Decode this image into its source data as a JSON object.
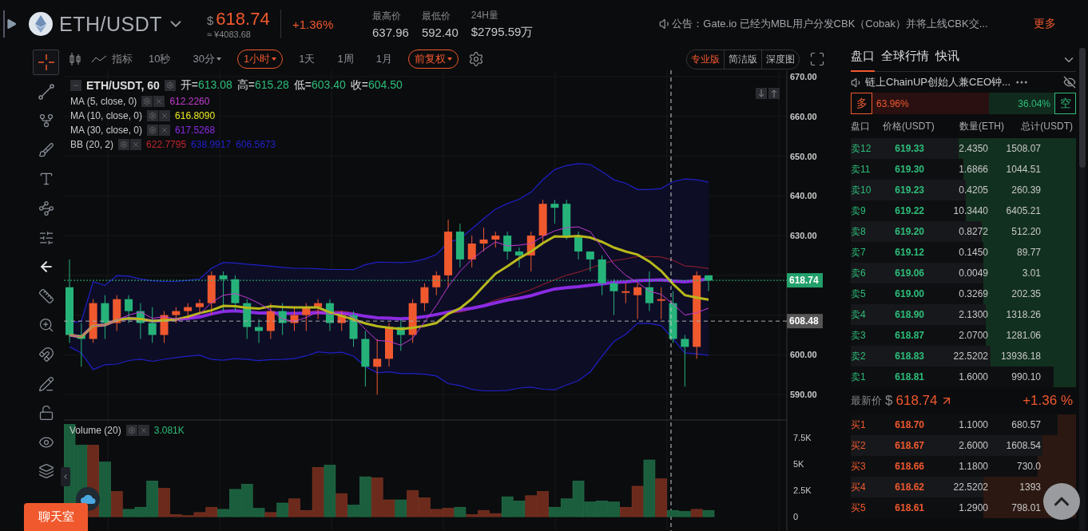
{
  "header": {
    "pair": "ETH/USDT",
    "price_symbol": "$",
    "price": "618.74",
    "price_cny": "≈ ¥4083.68",
    "change": "+1.36%",
    "stats": [
      {
        "label": "最高价",
        "value": "637.96"
      },
      {
        "label": "最低价",
        "value": "592.40"
      },
      {
        "label": "24H量",
        "value": "$2795.59万"
      }
    ],
    "notice": "公告：Gate.io 已经为MBL用户分发CBK（Cobak）并将上线CBK交...",
    "more": "更多"
  },
  "tools": [
    {
      "kind": "crosshair",
      "selected": true
    },
    {
      "kind": "line",
      "selected": false
    },
    {
      "kind": "fork",
      "selected": false
    },
    {
      "kind": "brush",
      "selected": false
    },
    {
      "kind": "text",
      "selected": false
    },
    {
      "kind": "pattern",
      "selected": false
    },
    {
      "kind": "sliders",
      "selected": false
    },
    {
      "kind": "back",
      "selected": false
    },
    {
      "kind": "ruler",
      "selected": false
    },
    {
      "kind": "zoom",
      "selected": false
    },
    {
      "kind": "magnet",
      "selected": false
    },
    {
      "kind": "pencil",
      "selected": false
    },
    {
      "kind": "unlock",
      "selected": false
    },
    {
      "kind": "eye",
      "selected": false
    },
    {
      "kind": "layers",
      "selected": false
    }
  ],
  "chart_toolbar": {
    "indicator_label": "指标",
    "intervals": [
      {
        "label": "10秒",
        "menu": false,
        "selected": false
      },
      {
        "label": "30分",
        "menu": true,
        "selected": false
      },
      {
        "label": "1小时",
        "menu": true,
        "selected": true
      },
      {
        "label": "1天",
        "menu": false,
        "selected": false
      },
      {
        "label": "1周",
        "menu": false,
        "selected": false
      },
      {
        "label": "1月",
        "menu": false,
        "selected": false
      }
    ],
    "adjust": "前复权",
    "views": [
      {
        "label": "专业版",
        "selected": true
      },
      {
        "label": "简洁版",
        "selected": false
      },
      {
        "label": "深度图",
        "selected": false
      }
    ]
  },
  "legend": {
    "title": "ETH/USDT, 60",
    "ohlc": [
      {
        "label": "开=",
        "value": "613.08"
      },
      {
        "label": "高=",
        "value": "615.28"
      },
      {
        "label": "低=",
        "value": "603.40"
      },
      {
        "label": "收=",
        "value": "604.50"
      }
    ],
    "indicators": [
      {
        "name": "MA (5, close, 0)",
        "values": [
          {
            "text": "612.2260",
            "color": "#c23ccf"
          }
        ]
      },
      {
        "name": "MA (10, close, 0)",
        "values": [
          {
            "text": "616.8090",
            "color": "#e8e820"
          }
        ]
      },
      {
        "name": "MA (30, close, 0)",
        "values": [
          {
            "text": "617.5268",
            "color": "#8a2be2"
          }
        ]
      },
      {
        "name": "BB (20, 2)",
        "values": [
          {
            "text": "622.7795",
            "color": "#c0262d"
          },
          {
            "text": "638.9917",
            "color": "#2020c8"
          },
          {
            "text": "606.5673",
            "color": "#2020c8"
          }
        ]
      }
    ]
  },
  "price_chart": {
    "axis_labels": [
      "670.00",
      "660.00",
      "650.00",
      "640.00",
      "630.00",
      "600.00",
      "590.00"
    ],
    "price_tags": [
      {
        "kind": "last",
        "text": "618.74"
      },
      {
        "kind": "cross",
        "text": "608.48"
      }
    ]
  },
  "volume": {
    "title": "Volume (20)",
    "value": "3.081K",
    "axis_labels": [
      "7.5K",
      "5K",
      "2.5K",
      "0"
    ]
  },
  "chat_button": "聊天室",
  "right_panel": {
    "tabs": [
      {
        "label": "盘口",
        "selected": true
      },
      {
        "label": "全球行情",
        "selected": false
      },
      {
        "label": "快讯",
        "selected": false
      }
    ],
    "notice": "链上ChainUP创始人兼CEO钟...",
    "sentiment": {
      "long_label": "多",
      "long_value": "63.96%",
      "short_value": "36.04%",
      "short_label": "空",
      "level": 0.6396
    },
    "columns": [
      "盘口",
      "价格(USDT)",
      "数量(ETH)",
      "总计(USDT)"
    ],
    "asks": [
      {
        "label": "卖12",
        "price": "619.33",
        "amount": "2.4350",
        "total": "1508.07",
        "level": 0.52
      },
      {
        "label": "卖11",
        "price": "619.30",
        "amount": "1.6866",
        "total": "1044.51",
        "level": 0.5
      },
      {
        "label": "卖10",
        "price": "619.23",
        "amount": "0.4205",
        "total": "260.39",
        "level": 0.49
      },
      {
        "label": "卖9",
        "price": "619.22",
        "amount": "10.3440",
        "total": "6405.21",
        "level": 0.49
      },
      {
        "label": "卖8",
        "price": "619.20",
        "amount": "0.8272",
        "total": "512.20",
        "level": 0.42
      },
      {
        "label": "卖7",
        "price": "619.12",
        "amount": "0.1450",
        "total": "89.77",
        "level": 0.41
      },
      {
        "label": "卖6",
        "price": "619.06",
        "amount": "0.0049",
        "total": "3.01",
        "level": 0.41
      },
      {
        "label": "卖5",
        "price": "619.00",
        "amount": "0.3269",
        "total": "202.35",
        "level": 0.41
      },
      {
        "label": "卖4",
        "price": "618.90",
        "amount": "2.1300",
        "total": "1318.26",
        "level": 0.4
      },
      {
        "label": "卖3",
        "price": "618.87",
        "amount": "2.0700",
        "total": "1281.06",
        "level": 0.4
      },
      {
        "label": "卖2",
        "price": "618.83",
        "amount": "22.5202",
        "total": "13936.18",
        "level": 0.38
      },
      {
        "label": "卖1",
        "price": "618.81",
        "amount": "1.6000",
        "total": "990.10",
        "level": 0.1
      }
    ],
    "last": {
      "label": "最新价",
      "symbol": "$",
      "price": "618.74",
      "change": "+1.36 %"
    },
    "bids": [
      {
        "label": "买1",
        "price": "618.70",
        "amount": "1.1000",
        "total": "680.57",
        "level": 0.08
      },
      {
        "label": "买2",
        "price": "618.67",
        "amount": "2.6000",
        "total": "1608.54",
        "level": 0.15
      },
      {
        "label": "买3",
        "price": "618.66",
        "amount": "1.1800",
        "total": "730.0",
        "level": 0.17
      },
      {
        "label": "买4",
        "price": "618.62",
        "amount": "22.5202",
        "total": "1393",
        "level": 0.41
      },
      {
        "label": "买5",
        "price": "618.61",
        "amount": "1.2900",
        "total": "798.01",
        "level": 0.41
      }
    ]
  }
}
